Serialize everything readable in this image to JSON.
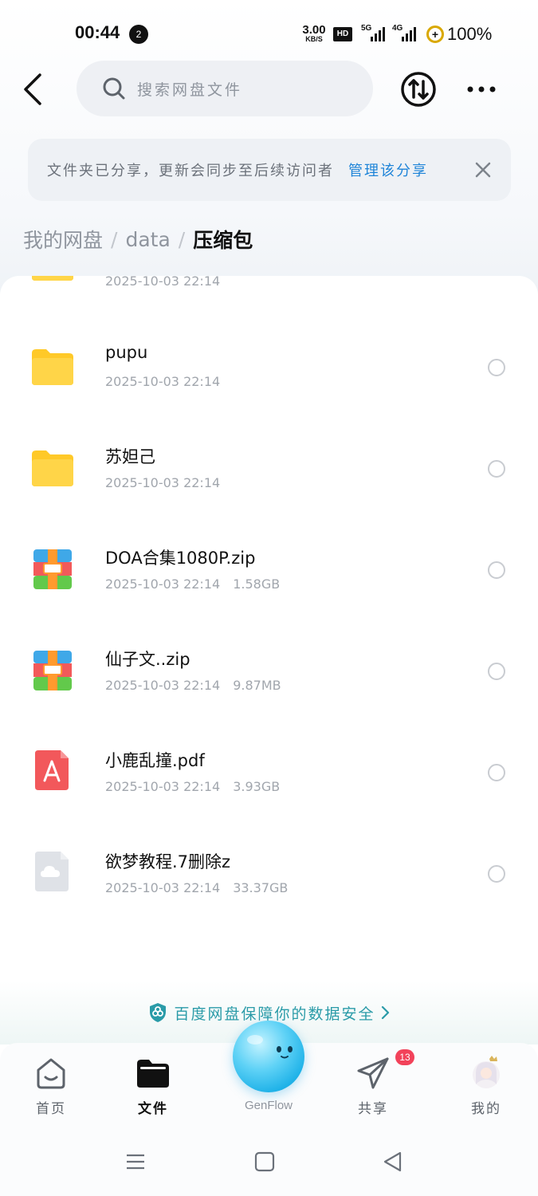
{
  "status_bar": {
    "time": "00:44",
    "notification_count": "2",
    "net_speed_value": "3.00",
    "net_speed_unit": "KB/S",
    "hd_label": "HD",
    "signal_1": "5G",
    "signal_2": "4G",
    "battery": "100%"
  },
  "header": {
    "search_placeholder": "搜索网盘文件"
  },
  "share_notice": {
    "message": "文件夹已分享，更新会同步至后续访问者",
    "manage_link": "管理该分享"
  },
  "breadcrumb": {
    "items": [
      "我的网盘",
      "data"
    ],
    "current": "压缩包"
  },
  "files": [
    {
      "name": "",
      "date": "2025-10-03  22:14",
      "size": "",
      "type": "folder"
    },
    {
      "name": "pupu",
      "date": "2025-10-03  22:14",
      "size": "",
      "type": "folder"
    },
    {
      "name": "苏妲己",
      "date": "2025-10-03  22:14",
      "size": "",
      "type": "folder"
    },
    {
      "name": "DOA合集1080P.zip",
      "date": "2025-10-03  22:14",
      "size": "1.58GB",
      "type": "zip"
    },
    {
      "name": "仙子文..zip",
      "date": "2025-10-03  22:14",
      "size": "9.87MB",
      "type": "zip"
    },
    {
      "name": "小鹿乱撞.pdf",
      "date": "2025-10-03  22:14",
      "size": "3.93GB",
      "type": "pdf"
    },
    {
      "name": "欲梦教程.7删除z",
      "date": "2025-10-03  22:14",
      "size": "33.37GB",
      "type": "unknown"
    }
  ],
  "security_banner": {
    "text": "百度网盘保障你的数据安全"
  },
  "bottom_nav": {
    "home": "首页",
    "files": "文件",
    "genflow": "GenFlow",
    "share": "共享",
    "share_badge": "13",
    "mine": "我的"
  },
  "colors": {
    "accent_blue": "#1e84d8",
    "security_teal": "#2a9ba8",
    "badge_red": "#f2425a",
    "folder_yellow": "#ffc928"
  }
}
